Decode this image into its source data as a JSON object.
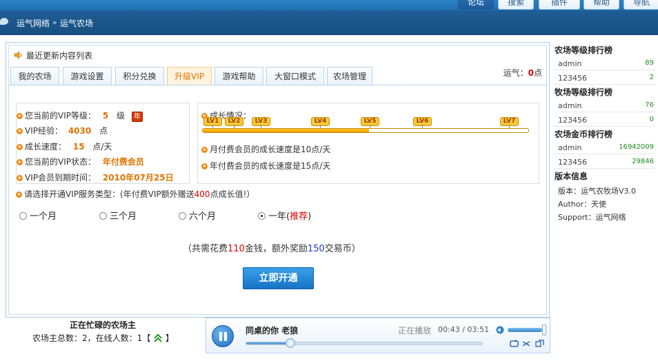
{
  "topnav": {
    "tabs": [
      "论坛",
      "搜索",
      "插件",
      "帮助",
      "导航"
    ]
  },
  "breadcrumb": {
    "items": [
      "运气网络",
      "运气农场"
    ],
    "separator": "»"
  },
  "main": {
    "recent_title": "最近更新内容列表",
    "tabs": [
      "我的农场",
      "游戏设置",
      "积分兑换",
      "升级VIP",
      "游戏帮助",
      "大窗口模式",
      "农场管理"
    ],
    "active_tab": "升级VIP",
    "luck_label": "运气：",
    "luck_value": "0",
    "luck_unit": "点"
  },
  "vip": {
    "level_label": "您当前的VIP等级：",
    "level_value": "5",
    "level_unit": "级",
    "level_badge": "年",
    "exp_label": "VIP经验：",
    "exp_value": "4030",
    "exp_unit": "点",
    "speed_label": "成长速度：",
    "speed_value": "15",
    "speed_unit": "点/天",
    "status_label": "您当前的VIP状态：",
    "status_value": "年付费会员",
    "expire_label": "VIP会员到期时间：",
    "expire_value": "2010年07月25日"
  },
  "growth": {
    "title": "成长情况：",
    "levels": [
      "LV1",
      "LV2",
      "LV3",
      "LV4",
      "LV5",
      "LV6",
      "LV7"
    ],
    "progress_fraction": 0.51,
    "monthly_note": "月付费会员的成长速度是10点/天",
    "yearly_note": "年付费会员的成长速度是15点/天"
  },
  "service": {
    "prompt_pre": "请选择开通VIP服务类型：(年付费VIP额外赠送",
    "prompt_bonus": "400",
    "prompt_post": "点成长值!）",
    "options": [
      "一个月",
      "三个月",
      "六个月",
      "一年("
    ],
    "recommend": "推荐",
    "recommend_close": ")",
    "selected_index": 3,
    "cost_pre": "（共需花费",
    "cost_money": "110",
    "cost_mid": "金钱，额外奖励",
    "cost_coins": "150",
    "cost_post": "交易币）",
    "submit_label": "立即开通"
  },
  "sidebar": {
    "farm_rank_title": "农场等级排行榜",
    "farm_rank": [
      {
        "name": "admin",
        "value": "89"
      },
      {
        "name": "123456",
        "value": "2"
      }
    ],
    "ranch_rank_title": "牧场等级排行榜",
    "ranch_rank": [
      {
        "name": "admin",
        "value": "76"
      },
      {
        "name": "123456",
        "value": "0"
      }
    ],
    "gold_rank_title": "农场金币排行榜",
    "gold_rank": [
      {
        "name": "admin",
        "value": "16942009"
      },
      {
        "name": "123456",
        "value": "29846"
      }
    ],
    "version_title": "版本信息",
    "version_lines": [
      "版本：运气农牧场V3.0",
      "Author：天使",
      "Support：运气网络"
    ]
  },
  "busy": {
    "title": "正在忙碌的农场主",
    "total_label": "农场主总数：",
    "total_value": "2",
    "online_label": "，在线人数：",
    "online_value": "1",
    "bracket_open": "【",
    "bracket_close": "】"
  },
  "player": {
    "song": "同桌的你  老狼",
    "status": "正在播放",
    "time": "00:43 / 03:51",
    "progress_fraction": 0.186,
    "volume_fraction": 0.92
  },
  "colors": {
    "accent_orange": "#e07400",
    "accent_red": "#e00000",
    "nav_blue": "#1f5e96"
  }
}
